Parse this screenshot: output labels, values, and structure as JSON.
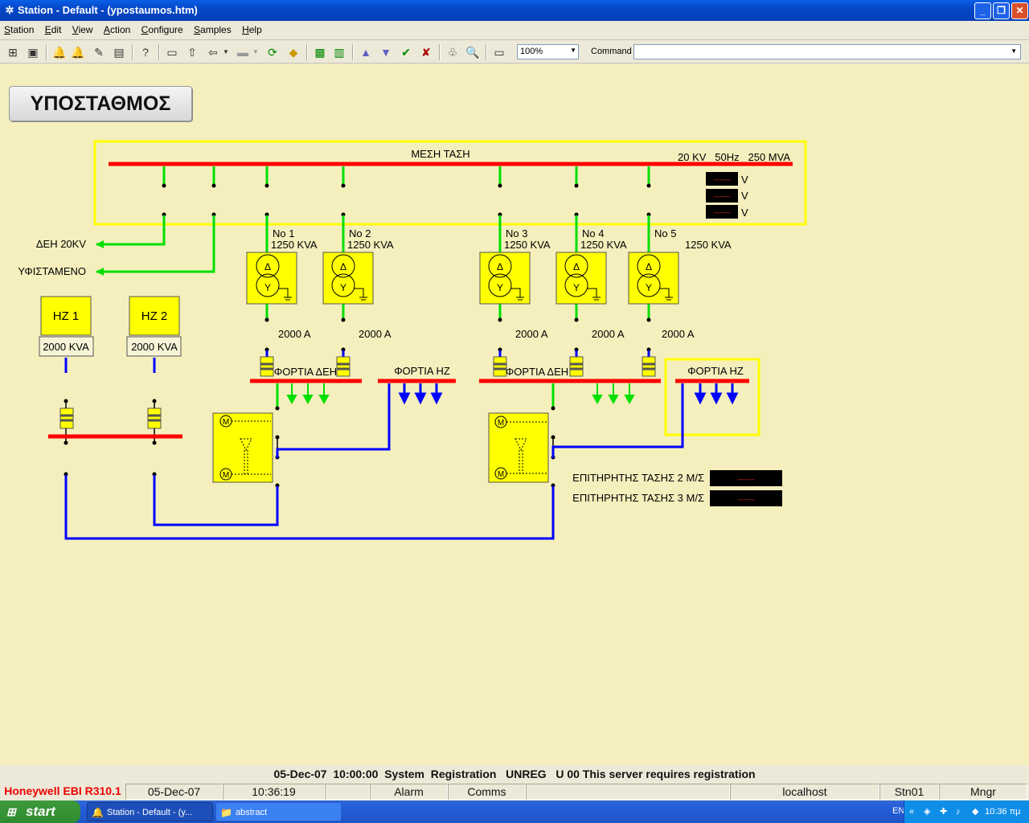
{
  "window": {
    "title": "Station - Default - (ypostaumos.htm)"
  },
  "menu": [
    "Station",
    "Edit",
    "View",
    "Action",
    "Configure",
    "Samples",
    "Help"
  ],
  "toolbar": {
    "zoom": "100%",
    "command_label": "Command",
    "command_value": ""
  },
  "page_title": "ΥΠΟΣΤΑΘΜΟΣ",
  "diagram": {
    "mv_label": "ΜΕΣΗ ΤΑΣΗ",
    "mv_specs": "20 KV   50Hz   250 MVA",
    "volt_unit": "V",
    "volt_placeholder": "--------",
    "feed_dei": "ΔΕΗ 20KV",
    "feed_existing": "ΥΦΙΣΤΑΜΕΝΟ",
    "transformers": [
      {
        "name": "No 1",
        "rating": "1250 KVA",
        "current": "2000 A"
      },
      {
        "name": "No 2",
        "rating": "1250 KVA",
        "current": "2000 A"
      },
      {
        "name": "No 3",
        "rating": "1250 KVA",
        "current": "2000 A"
      },
      {
        "name": "No 4",
        "rating": "1250 KVA",
        "current": "2000 A"
      },
      {
        "name": "No 5",
        "rating": "1250 KVA",
        "current": "2000 A"
      }
    ],
    "winding_top": "Δ",
    "winding_bottom": "Y",
    "generators": [
      {
        "name": "HZ 1",
        "rating": "2000 KVA"
      },
      {
        "name": "HZ 2",
        "rating": "2000 KVA"
      }
    ],
    "load_dei": "ΦΟΡΤΙΑ ΔΕΗ",
    "load_hz": "ΦΟΡΤΙΑ HZ",
    "motor_symbol": "M",
    "monitor_2": "ΕΠΙΤΗΡΗΤΗΣ ΤΑΣΗΣ 2 Μ/Σ",
    "monitor_3": "ΕΠΙΤΗΡΗΤΗΣ ΤΑΣΗΣ 3 Μ/Σ",
    "monitor_placeholder": "--------"
  },
  "status": {
    "alarm_line": "05-Dec-07  10:00:00  System  Registration   UNREG   U 00 This server requires registration",
    "product": "Honeywell EBI R310.1",
    "date": "05-Dec-07",
    "time": "10:36:19",
    "alarm": "Alarm",
    "comms": "Comms",
    "host": "localhost",
    "station": "Stn01",
    "level": "Mngr"
  },
  "taskbar": {
    "start": "start",
    "tasks": [
      "Station - Default - (y...",
      "abstract"
    ],
    "lang": "EN",
    "clock": "10:36 πμ"
  },
  "colors": {
    "bus": "#ff0000",
    "feeder": "#00e000",
    "hz_line": "#0000ff",
    "highlight_frame": "#ffff00",
    "equip_fill": "#ffff00"
  }
}
